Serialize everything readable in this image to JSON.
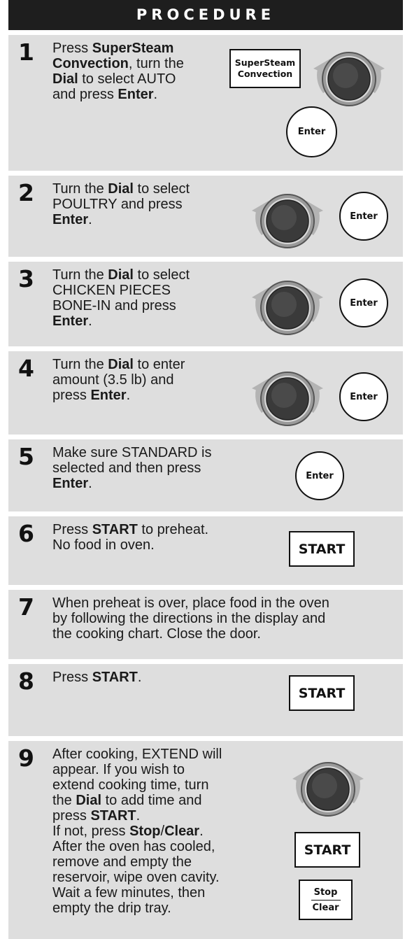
{
  "header": {
    "title": "PROCEDURE"
  },
  "buttons": {
    "enter": "Enter",
    "start": "START",
    "supersteam_line1": "SuperSteam",
    "supersteam_line2": "Convection",
    "stop": "Stop",
    "clear": "Clear"
  },
  "steps": [
    {
      "num": "1",
      "lines": [
        [
          "Press ",
          "SuperSteam"
        ],
        [
          "Convection",
          ", turn the"
        ],
        [
          "Dial",
          " to select AUTO"
        ],
        [
          "and press ",
          "Enter",
          "."
        ]
      ]
    },
    {
      "num": "2",
      "lines": [
        [
          "Turn the ",
          "Dial",
          " to select"
        ],
        [
          "POULTRY and press"
        ],
        [
          "Enter",
          "."
        ]
      ]
    },
    {
      "num": "3",
      "lines": [
        [
          "Turn the ",
          "Dial",
          " to select"
        ],
        [
          "CHICKEN PIECES"
        ],
        [
          "BONE-IN and press"
        ],
        [
          "Enter",
          "."
        ]
      ]
    },
    {
      "num": "4",
      "lines": [
        [
          "Turn the ",
          "Dial",
          " to enter"
        ],
        [
          "amount (3.5 lb) and"
        ],
        [
          "press ",
          "Enter",
          "."
        ]
      ]
    },
    {
      "num": "5",
      "lines": [
        [
          "Make sure STANDARD is"
        ],
        [
          "selected and then press"
        ],
        [
          "Enter",
          "."
        ]
      ]
    },
    {
      "num": "6",
      "lines": [
        [
          "Press ",
          "START",
          " to preheat."
        ],
        [
          "No food in oven."
        ]
      ]
    },
    {
      "num": "7",
      "lines": [
        [
          "When preheat is over, place food in the oven"
        ],
        [
          "by following the directions in the display and"
        ],
        [
          "the cooking chart. Close the door."
        ]
      ]
    },
    {
      "num": "8",
      "lines": [
        [
          "Press ",
          "START",
          "."
        ]
      ]
    },
    {
      "num": "9",
      "lines": [
        [
          "After cooking, EXTEND will"
        ],
        [
          "appear. If you wish to"
        ],
        [
          "extend cooking time, turn"
        ],
        [
          "the ",
          "Dial",
          " to add time and"
        ],
        [
          "press ",
          "START",
          "."
        ],
        [
          "If not, press ",
          "Stop",
          "/",
          "Clear",
          "."
        ],
        [
          "After the oven has cooled,"
        ],
        [
          "remove and empty the"
        ],
        [
          "reservoir, wipe oven cavity."
        ],
        [
          "Wait a few minutes, then"
        ],
        [
          "empty the drip tray."
        ]
      ]
    }
  ]
}
